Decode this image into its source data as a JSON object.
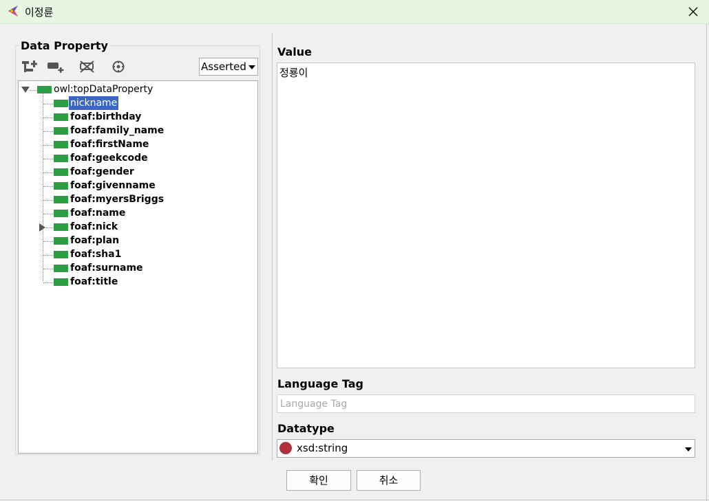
{
  "window": {
    "title": "이정륜",
    "app_icon": "protege-app-icon",
    "close_icon": "close-icon"
  },
  "data_property": {
    "group_title": "Data Property",
    "toolbar": [
      {
        "name": "add-subproperty-icon"
      },
      {
        "name": "add-sibling-icon"
      },
      {
        "name": "delete-property-icon"
      },
      {
        "name": "target-icon"
      }
    ],
    "view_mode": "Asserted",
    "tree": {
      "root": "owl:topDataProperty",
      "children": [
        {
          "label": "nickname",
          "selected": true
        },
        {
          "label": "foaf:birthday"
        },
        {
          "label": "foaf:family_name"
        },
        {
          "label": "foaf:firstName"
        },
        {
          "label": "foaf:geekcode"
        },
        {
          "label": "foaf:gender"
        },
        {
          "label": "foaf:givenname"
        },
        {
          "label": "foaf:myersBriggs"
        },
        {
          "label": "foaf:name"
        },
        {
          "label": "foaf:nick",
          "expandable": true
        },
        {
          "label": "foaf:plan"
        },
        {
          "label": "foaf:sha1"
        },
        {
          "label": "foaf:surname"
        },
        {
          "label": "foaf:title"
        }
      ]
    }
  },
  "value": {
    "label": "Value",
    "text": "정룡이"
  },
  "language_tag": {
    "label": "Language Tag",
    "placeholder": "Language Tag",
    "value": ""
  },
  "datatype": {
    "label": "Datatype",
    "selected": "xsd:string",
    "icon_color": "#b0303b"
  },
  "buttons": {
    "ok": "확인",
    "cancel": "취소"
  },
  "colors": {
    "property_icon": "#2e9e44",
    "selection": "#3b66c3",
    "titlebar": "#e8f5e3"
  }
}
